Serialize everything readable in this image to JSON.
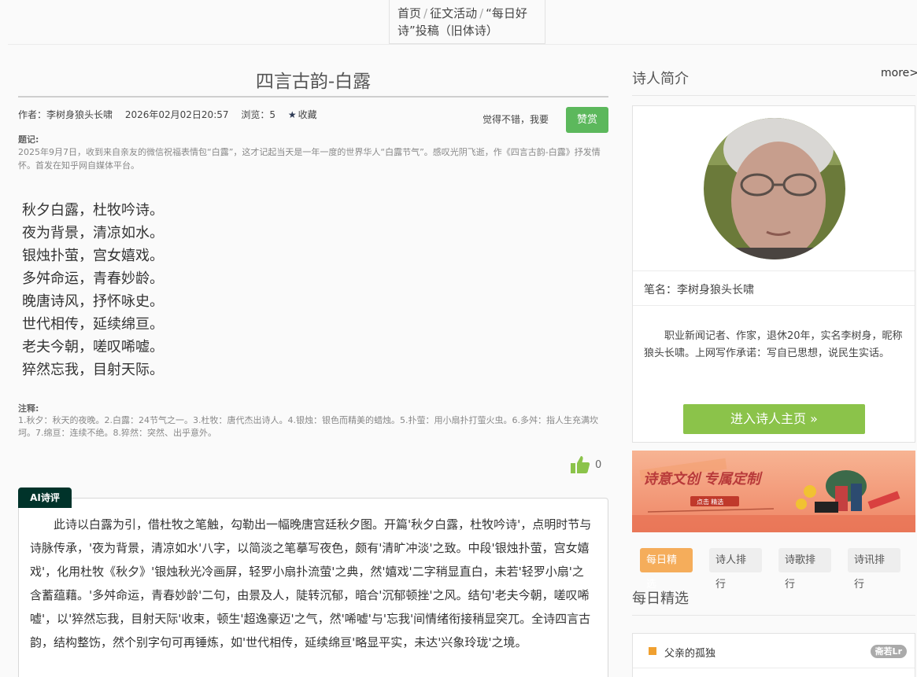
{
  "breadcrumb": {
    "home": "首页",
    "sep1": "/",
    "activity": "征文活动",
    "sep2": "/",
    "current": "“每日好诗”投稿（旧体诗）"
  },
  "article": {
    "title": "四言古韵-白露",
    "author": "作者：李树身狼头长啸",
    "date": "2026年02月02日20:57",
    "views": "浏览：5",
    "favorite": "收藏",
    "praise_text": "觉得不错，我要",
    "praise_button": "赞赏",
    "note_label": "题记:",
    "note_text": "2025年9月7日，收到来自亲友的微信祝福表情包“白露”，这才记起当天是一年一度的世界华人“白露节气”。感叹光阴飞逝，作《四言古韵-白露》抒发情怀。首发在知乎网自媒体平台。",
    "poem": [
      "秋夕白露，杜牧吟诗。",
      "夜为背景，清凉如水。",
      "银烛扑萤，宫女嬉戏。",
      "多舛命运，青春妙龄。",
      "晚唐诗风，抒怀咏史。",
      "世代相传，延续绵亘。",
      "老夫今朝，嗟叹唏嘘。",
      "猝然忘我，目射天际。"
    ],
    "annotation_label": "注释:",
    "annotation_text": "1.秋夕：秋天的夜晚。2.白露：24节气之一。3.杜牧：唐代杰出诗人。4.银烛：银色而精美的蜡烛。5.扑萤：用小扇扑打萤火虫。6.多舛：指人生充满坎坷。7.绵亘：连续不绝。8.猝然：突然、出乎意外。",
    "like_count": "0"
  },
  "ai_review": {
    "tag": "AI诗评",
    "text": "此诗以白露为引，借杜牧之笔触，勾勒出一幅晚唐宫廷秋夕图。开篇'秋夕白露，杜牧吟诗'，点明时节与诗脉传承，'夜为背景，清凉如水'八字，以简淡之笔摹写夜色，颇有'清旷冲淡'之致。中段'银烛扑萤，宫女嬉戏'，化用杜牧《秋夕》'银烛秋光冷画屏，轻罗小扇扑流萤'之典，然'嬉戏'二字稍显直白，未若'轻罗小扇'之含蓄蕴藉。'多舛命运，青春妙龄'二句，由景及人，陡转沉郁，暗合'沉郁顿挫'之风。结句'老夫今朝，嗟叹唏嘘'，以'猝然忘我，目射天际'收束，顿生'超逸豪迈'之气，然'唏嘘'与'忘我'间情绪衔接稍显突兀。全诗四言古韵，结构整饬，然个别字句可再锤炼，如'世代相传，延续绵亘'略显平实，未达'兴象玲珑'之境。"
  },
  "sidebar": {
    "poet_section_title": "诗人简介",
    "more": "more>",
    "pen_name": "笔名：李树身狼头长啸",
    "bio": "职业新闻记者、作家，退休20年，实名李树身，昵称狼头长啸。上网写作承诺：写自已思想，说民生实话。",
    "enter_button": "进入诗人主页 »",
    "banner_text": "诗意文创  专属定制",
    "banner_sub": "点击 精选",
    "tabs": [
      "每日精选",
      "诗人排行",
      "诗歌排行",
      "诗讯排行"
    ],
    "daily_title": "每日精选",
    "daily_items": [
      {
        "title": "父亲的孤独",
        "badge": "斋若Lr"
      }
    ]
  },
  "colors": {
    "praise": "#5cb85c",
    "enter": "#8bc34a",
    "ai_tag": "#00332a",
    "tab_active": "#f5ad5b"
  }
}
